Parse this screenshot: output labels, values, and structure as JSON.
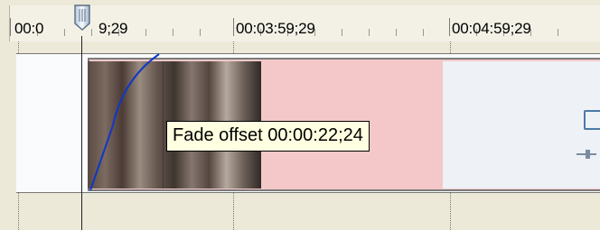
{
  "timeline": {
    "times": [
      "00:0",
      "9;29",
      "00:03:59;29",
      "00:04:59;29"
    ],
    "tooltip": "Fade offset 00:00:22;24"
  },
  "colors": {
    "background": "#ece9d8",
    "event": "#f4c8c8",
    "tooltip": "#ffffe1",
    "fade_line": "#1037c8",
    "cursor": "#222222"
  },
  "icons": {
    "playhead": "playhead-marker-icon",
    "handle": "event-edge-handle-icon"
  }
}
